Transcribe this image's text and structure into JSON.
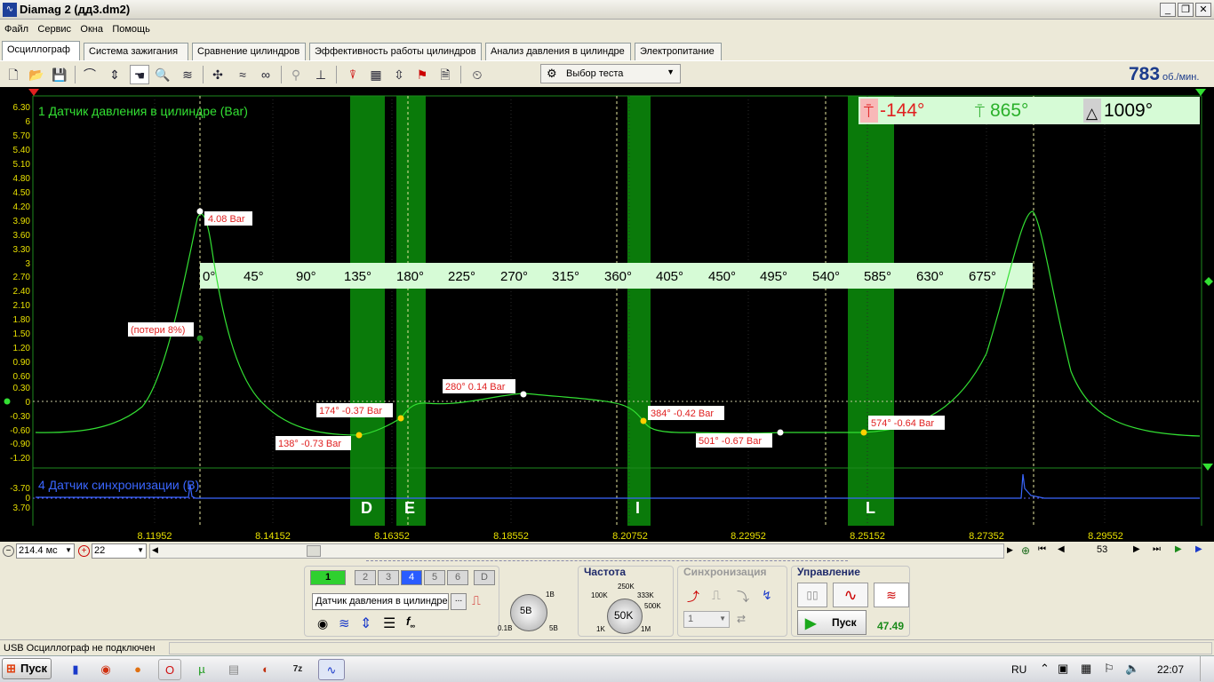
{
  "window": {
    "title": "Diamag 2 (дд3.dm2)",
    "minimize": "_",
    "restore": "❐",
    "close": "✕"
  },
  "menu": [
    "Файл",
    "Сервис",
    "Окна",
    "Помощь"
  ],
  "tabs": [
    "Осциллограф",
    "Система зажигания",
    "Сравнение цилиндров",
    "Эффективность работы цилиндров",
    "Анализ давления в цилиндре",
    "Электропитание"
  ],
  "toolbar": {
    "test_select": "Выбор теста",
    "rpm_value": "783",
    "rpm_unit": "об./мин."
  },
  "scope": {
    "channel1_label": "1 Датчик давления в цилиндре (Bar)",
    "channel4_label": "4 Датчик синхронизации (В)",
    "y_ticks": [
      "6.30",
      "6",
      "5.70",
      "5.40",
      "5.10",
      "4.80",
      "4.50",
      "4.20",
      "3.90",
      "3.60",
      "3.30",
      "3",
      "2.70",
      "2.40",
      "2.10",
      "1.80",
      "1.50",
      "1.20",
      "0.90",
      "0.60",
      "0.30",
      "0",
      "-0.30",
      "-0.60",
      "-0.90",
      "-1.20"
    ],
    "y_ticks_ch4": [
      "-3.70",
      "0",
      "3.70"
    ],
    "x_ticks": [
      "8.11952",
      "8.14152",
      "8.16352",
      "8.18552",
      "8.20752",
      "8.22952",
      "8.25152",
      "8.27352",
      "8.29552"
    ],
    "deg_ruler": [
      "0°",
      "45°",
      "90°",
      "135°",
      "180°",
      "225°",
      "270°",
      "315°",
      "360°",
      "405°",
      "450°",
      "495°",
      "540°",
      "585°",
      "630°",
      "675°"
    ],
    "phase_letters": [
      "D",
      "E",
      "I",
      "L"
    ],
    "info": {
      "angle1": "-144°",
      "angle2": "865°",
      "angle3": "1009°"
    },
    "annotations": {
      "peak": "4.08 Bar",
      "loss": "(потери 8%)",
      "p138": "138° -0.73 Bar",
      "p174": "174° -0.37 Bar",
      "p280": "280° 0.14 Bar",
      "p384": "384° -0.42 Bar",
      "p501": "501° -0.67 Bar",
      "p574": "574° -0.64 Bar"
    },
    "colors": {
      "trace": "#33e033",
      "sync": "#3a66ff",
      "band": "#0a7a0a",
      "label": "#e02020"
    }
  },
  "navbar": {
    "timebase": "214.4 мс",
    "zoom": "22",
    "page": "53"
  },
  "channels": {
    "buttons": [
      "1",
      "2",
      "3",
      "4",
      "5",
      "6",
      "D"
    ],
    "sensor": "Датчик давления в цилиндре",
    "browse": "...",
    "scale_value": "5В",
    "scale_min": "0.1В",
    "scale_max": "1В",
    "scale_max2": "5В"
  },
  "freq": {
    "title": "Частота",
    "value": "50K",
    "ticks": [
      "100K",
      "250K",
      "333K",
      "500K",
      "1K",
      "1M"
    ]
  },
  "sync": {
    "title": "Синхронизация",
    "channel": "1"
  },
  "control": {
    "title": "Управление",
    "start": "Пуск",
    "fps": "47.49"
  },
  "status": {
    "text": "USB Осциллограф не подключен"
  },
  "taskbar": {
    "start": "Пуск",
    "lang": "RU",
    "time": "22:07"
  }
}
